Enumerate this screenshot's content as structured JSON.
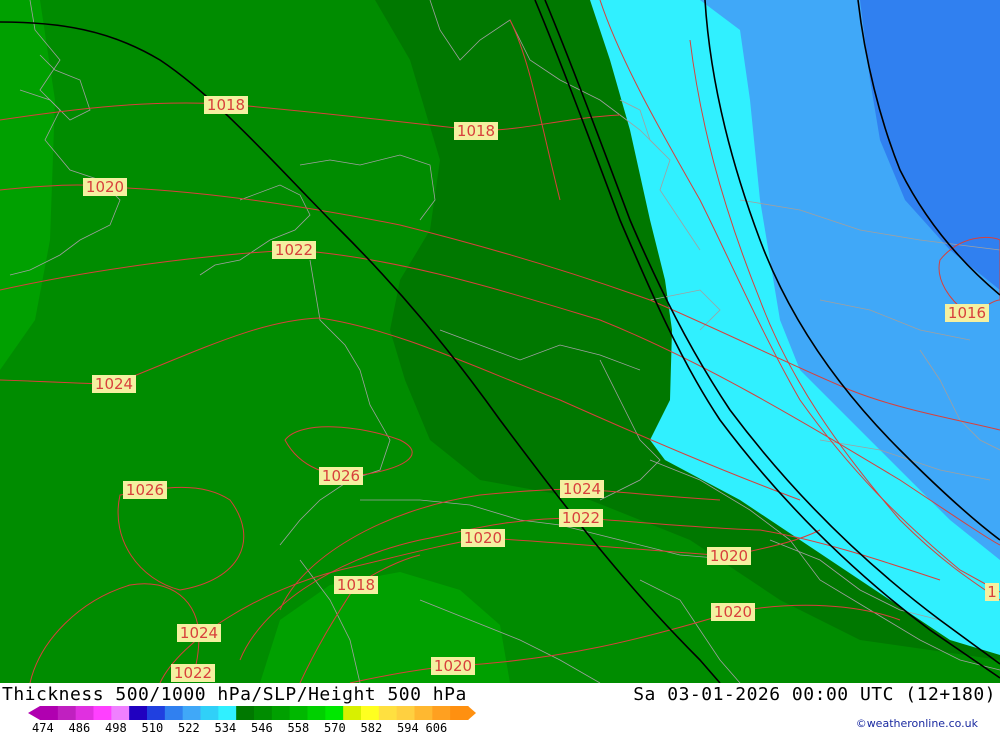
{
  "title": "Thickness 500/1000 hPa/SLP/Height 500 hPa",
  "datetime": "Sa 03-01-2026 00:00 UTC (12+180)",
  "credit": "©weatheronline.co.uk",
  "colors": {
    "sea_level_contour": "#d8403c",
    "height_contour": "#000000",
    "label_bg": "#f4f0a0",
    "thickness_bands": [
      "#b000b0",
      "#c020c0",
      "#e030e0",
      "#ff40ff",
      "#f080ff",
      "#2000c0",
      "#2040e0",
      "#3080f0",
      "#40a8f8",
      "#30d0f8",
      "#30f0ff",
      "#007800",
      "#008c00",
      "#00a000",
      "#00b800",
      "#00d000",
      "#00e800",
      "#d8f000",
      "#ffff20",
      "#ffe040",
      "#ffd040",
      "#ffb830",
      "#ffa020",
      "#ff9010"
    ]
  },
  "legend": {
    "ticks": [
      "474",
      "486",
      "498",
      "510",
      "522",
      "534",
      "546",
      "558",
      "570",
      "582",
      "594",
      "606"
    ]
  },
  "isobar_labels": [
    {
      "id": "a",
      "text": "1018"
    },
    {
      "id": "b",
      "text": "1018"
    },
    {
      "id": "c",
      "text": "1020"
    },
    {
      "id": "d",
      "text": "1022"
    },
    {
      "id": "e",
      "text": "1024"
    },
    {
      "id": "f",
      "text": "1026"
    },
    {
      "id": "g",
      "text": "1026"
    },
    {
      "id": "h",
      "text": "1024"
    },
    {
      "id": "i",
      "text": "1022"
    },
    {
      "id": "j",
      "text": "1020"
    },
    {
      "id": "k",
      "text": "1020"
    },
    {
      "id": "l",
      "text": "1018"
    },
    {
      "id": "m",
      "text": "1020"
    },
    {
      "id": "n",
      "text": "1024"
    },
    {
      "id": "o",
      "text": "1022"
    },
    {
      "id": "p",
      "text": "1020"
    },
    {
      "id": "q",
      "text": "1016"
    },
    {
      "id": "r",
      "text": "1"
    }
  ]
}
